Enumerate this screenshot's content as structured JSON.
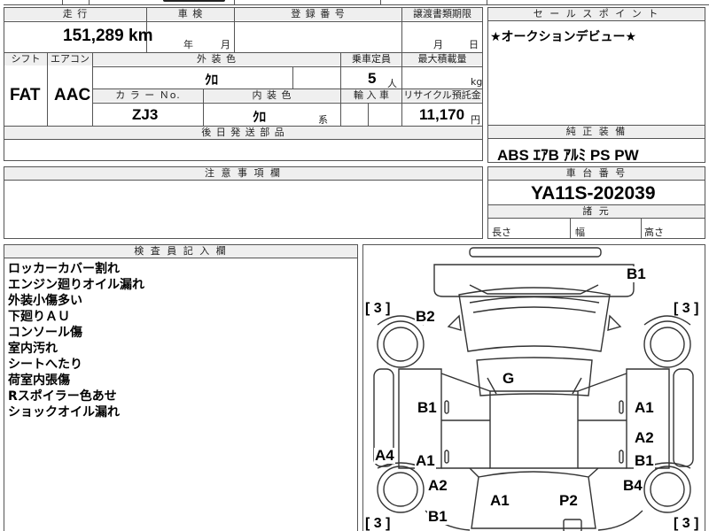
{
  "top_strip": {
    "partial_text": "四 / 月 / 人"
  },
  "mileage": {
    "header": "走 行",
    "value": "151,289",
    "unit": "km"
  },
  "inspection": {
    "header": "車 検",
    "year_unit": "年",
    "month_unit": "月"
  },
  "registration": {
    "header": "登 録 番 号"
  },
  "transfer_deadline": {
    "header": "譲渡書類期限",
    "month_unit": "月",
    "day_unit": "日"
  },
  "shift": {
    "header": "シフト",
    "value": "FAT"
  },
  "aircon": {
    "header": "エアコン",
    "value": "AAC"
  },
  "exterior_color": {
    "header": "外 装 色",
    "value": "ｸﾛ"
  },
  "capacity": {
    "header": "乗車定員",
    "value": "5",
    "unit": "人"
  },
  "max_load": {
    "header": "最大積載量",
    "unit": "kg"
  },
  "color_no": {
    "header": "カ ラ ー Ｎo.",
    "value": "ZJ3"
  },
  "interior_color": {
    "header": "内 装 色",
    "value": "ｸﾛ",
    "suffix": "系"
  },
  "import": {
    "header": "輸 入 車"
  },
  "recycle": {
    "header": "リサイクル預託金",
    "value": "11,170",
    "unit": "円"
  },
  "later_parts": {
    "header": "後 日 発 送 部 品"
  },
  "notes_section": {
    "header": "注 意 事 項 欄"
  },
  "sales_point": {
    "header": "セ ー ル ス ポ イ ン ト",
    "text": "★オークションデビュー★"
  },
  "genuine_equipment": {
    "header": "純 正 装 備",
    "text": "ABS ｴｱB ｱﾙﾐ PS PW"
  },
  "chassis": {
    "header": "車 台 番 号",
    "value": "YA11S-202039"
  },
  "dimensions": {
    "header": "諸 元",
    "length": "長さ",
    "width": "幅",
    "height": "高さ"
  },
  "inspector": {
    "header": "検 査 員 記 入 欄",
    "notes": [
      "ロッカーカバー割れ",
      "エンジン廻りオイル漏れ",
      "外装小傷多い",
      "下廻りＡＵ",
      "コンソール傷",
      "室内汚れ",
      "シートへたり",
      "荷室内張傷",
      "Rスポイラー色あせ",
      "ショックオイル漏れ"
    ]
  },
  "damage_map": {
    "bracket_3": "[ 3 ]",
    "labels": {
      "b1_top_right": "B1",
      "b2": "B2",
      "g": "G",
      "b1_left": "B1",
      "a1_right": "A1",
      "a2_right": "A2",
      "b1_right": "B1",
      "a4": "A4",
      "a1_left": "A1",
      "a2_left": "A2",
      "b4": "B4",
      "b1_bottom_left": "B1",
      "a1_bottom": "A1",
      "p2": "P2"
    }
  }
}
